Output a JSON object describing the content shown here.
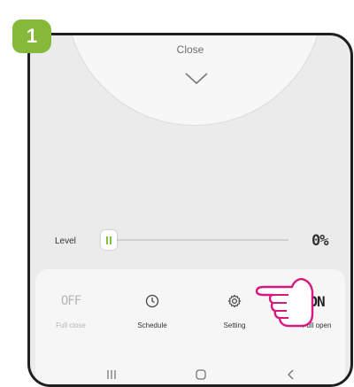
{
  "step": {
    "number": "1"
  },
  "dial": {
    "close_label": "Close"
  },
  "level": {
    "label": "Level",
    "value": "0%",
    "fraction": 0
  },
  "actions": [
    {
      "id": "off",
      "top": "OFF",
      "label": "Full close"
    },
    {
      "id": "schedule",
      "icon": "clock-icon",
      "label": "Schedule"
    },
    {
      "id": "setting",
      "icon": "gear-icon",
      "label": "Setting"
    },
    {
      "id": "on",
      "top": "ON",
      "label": "Full open"
    }
  ],
  "navbar": {
    "recents": "|||",
    "home": "home",
    "back": "back"
  },
  "colors": {
    "accent_green": "#86b83a",
    "pointer_magenta": "#d6197e",
    "slider_green": "#7dc242"
  }
}
